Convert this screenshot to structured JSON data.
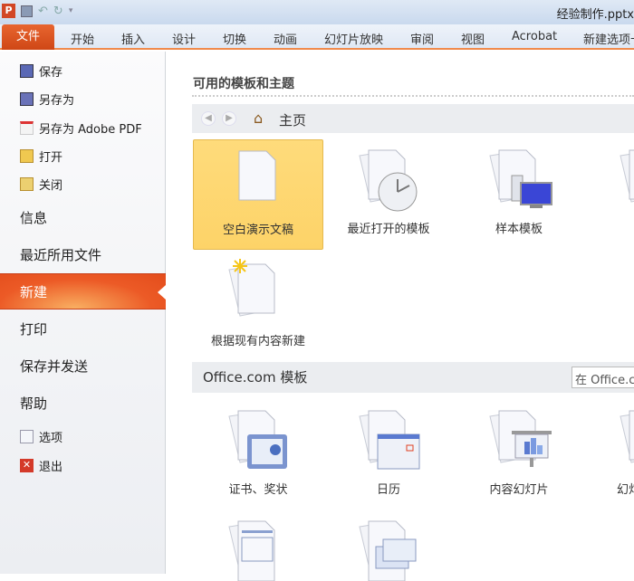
{
  "window": {
    "title": "经验制作.pptx"
  },
  "ribbon": {
    "file_tab": "文件",
    "tabs": [
      "开始",
      "插入",
      "设计",
      "切换",
      "动画",
      "幻灯片放映",
      "审阅",
      "视图",
      "Acrobat",
      "新建选项卡"
    ]
  },
  "sidebar": {
    "small_items": [
      {
        "label": "保存",
        "icon": "save-icon"
      },
      {
        "label": "另存为",
        "icon": "save-as-icon"
      },
      {
        "label": "另存为 Adobe PDF",
        "icon": "pdf-icon"
      },
      {
        "label": "打开",
        "icon": "open-folder-icon"
      },
      {
        "label": "关闭",
        "icon": "close-folder-icon"
      }
    ],
    "big_items": [
      "信息",
      "最近所用文件",
      "新建",
      "打印",
      "保存并发送",
      "帮助"
    ],
    "bottom_items": [
      {
        "label": "选项",
        "icon": "options-icon"
      },
      {
        "label": "退出",
        "icon": "exit-icon"
      }
    ],
    "selected": "新建"
  },
  "main": {
    "heading": "可用的模板和主题",
    "nav": {
      "location": "主页"
    },
    "templates": [
      "空白演示文稿",
      "最近打开的模板",
      "样本模板",
      "根据现有内容新建"
    ],
    "office": {
      "heading": "Office.com 模板",
      "search_placeholder": "在 Office.com 上搜索模板",
      "templates": [
        "证书、奖状",
        "日历",
        "内容幻灯片",
        "幻灯片背景"
      ]
    }
  },
  "colors": {
    "accent": "#e8652f",
    "selected_tile": "#fdd86e"
  }
}
